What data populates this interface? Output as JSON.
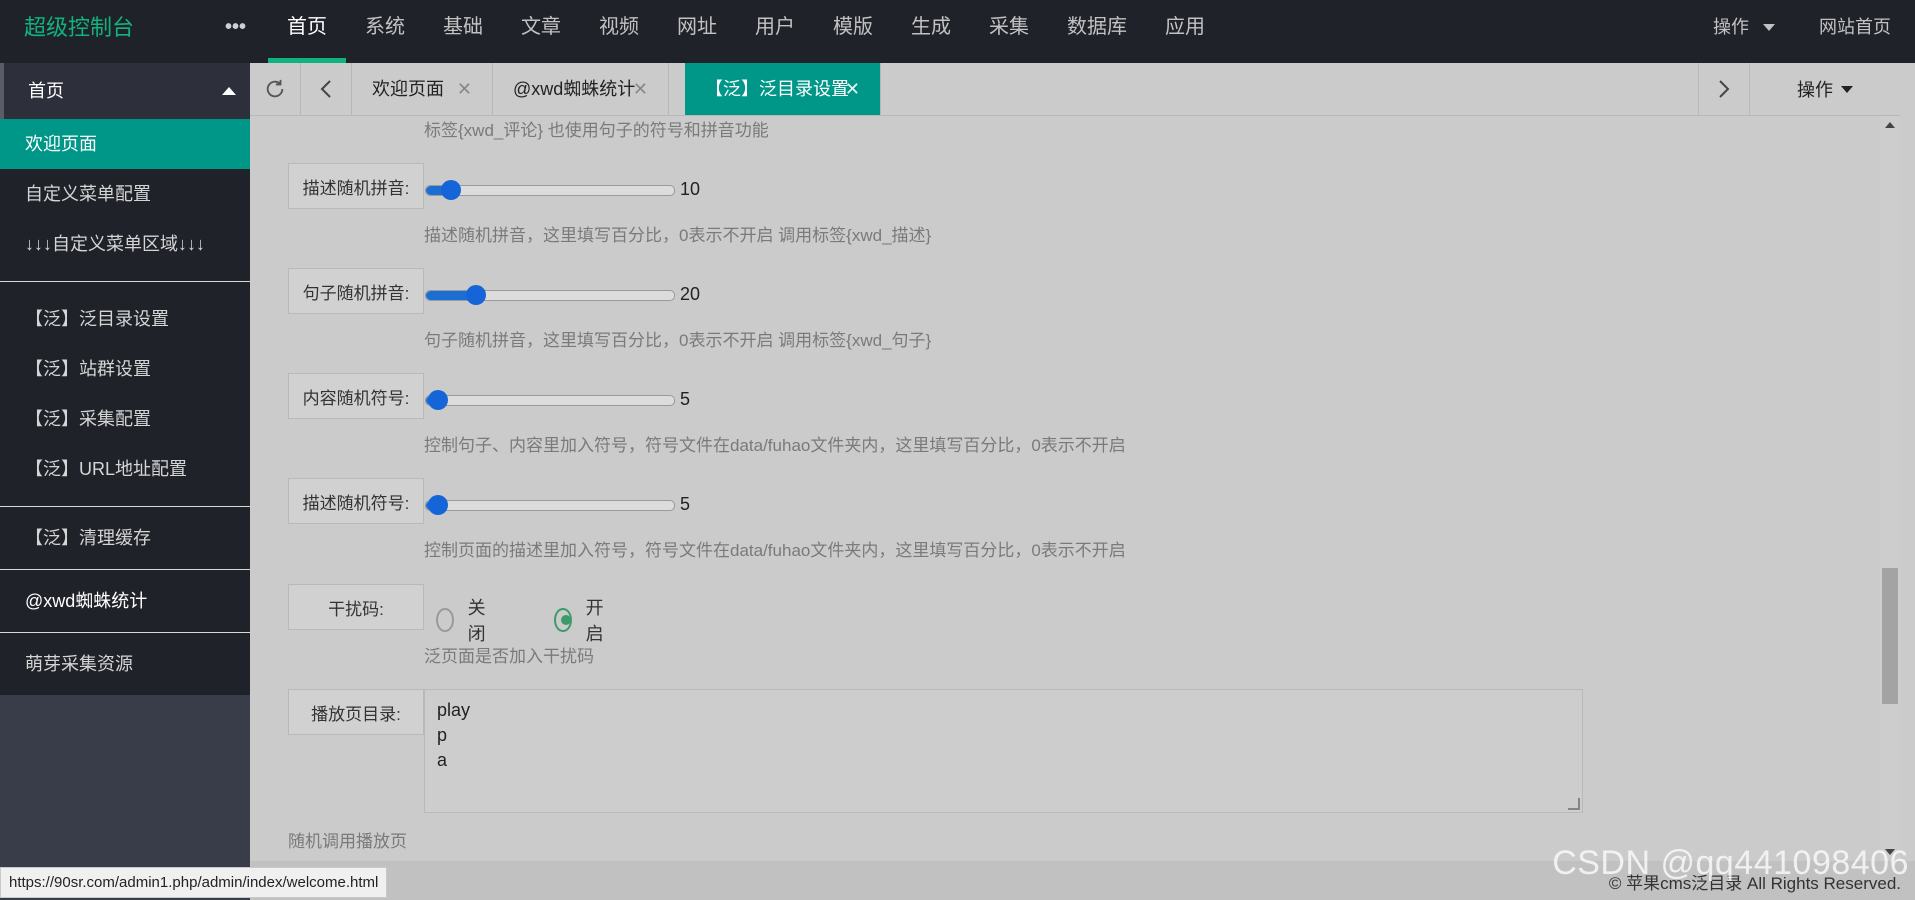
{
  "app": {
    "title": "超级控制台",
    "more": "•••"
  },
  "nav": [
    {
      "label": "首页",
      "active": true
    },
    {
      "label": "系统"
    },
    {
      "label": "基础"
    },
    {
      "label": "文章"
    },
    {
      "label": "视频"
    },
    {
      "label": "网址"
    },
    {
      "label": "用户"
    },
    {
      "label": "模版"
    },
    {
      "label": "生成"
    },
    {
      "label": "采集"
    },
    {
      "label": "数据库"
    },
    {
      "label": "应用"
    }
  ],
  "topright": {
    "ops": "操作",
    "site": "网站首页"
  },
  "sidebar": {
    "head": "首页",
    "group1": [
      "欢迎页面",
      "自定义菜单配置",
      "↓↓↓自定义菜单区域↓↓↓"
    ],
    "group2": [
      "【泛】泛目录设置",
      "【泛】站群设置",
      "【泛】采集配置",
      "【泛】URL地址配置"
    ],
    "group3": [
      "【泛】清理缓存"
    ],
    "group4": [
      "@xwd蜘蛛统计"
    ],
    "group5": [
      "萌芽采集资源"
    ]
  },
  "tabs": [
    {
      "label": "欢迎页面",
      "close": "✕"
    },
    {
      "label": "@xwd蜘蛛统计",
      "close": "✕"
    },
    {
      "label": "【泛】泛目录设置",
      "close": "✕",
      "active": true
    }
  ],
  "tabs_ops": "操作",
  "content": {
    "top_note": "标签{xwd_评论} 也使用句子的符号和拼音功能",
    "sliders": [
      {
        "label": "描述随机拼音:",
        "value": "10",
        "help": "描述随机拼音，这里填写百分比，0表示不开启 调用标签{xwd_描述}",
        "pct": 10
      },
      {
        "label": "句子随机拼音:",
        "value": "20",
        "help": "句子随机拼音，这里填写百分比，0表示不开启 调用标签{xwd_句子}",
        "pct": 20
      },
      {
        "label": "内容随机符号:",
        "value": "5",
        "help": "控制句子、内容里加入符号，符号文件在data/fuhao文件夹内，这里填写百分比，0表示不开启",
        "pct": 5
      },
      {
        "label": "描述随机符号:",
        "value": "5",
        "help": "控制页面的描述里加入符号，符号文件在data/fuhao文件夹内，这里填写百分比，0表示不开启",
        "pct": 5
      }
    ],
    "radio": {
      "label": "干扰码:",
      "off": "关闭",
      "on": "开启",
      "selected": "on",
      "help": "泛页面是否加入干扰码"
    },
    "textarea": {
      "label": "播放页目录:",
      "lines": [
        "play",
        "p",
        "a"
      ]
    },
    "bottom_note": "随机调用播放页"
  },
  "footer": {
    "copyright": "© 苹果cms泛目录 All Rights Reserved."
  },
  "status_url": "https://90sr.com/admin1.php/admin/index/welcome.html",
  "watermark": "CSDN @qq441098406",
  "colors": {
    "accent": "#10b37f",
    "active_tab": "#009688",
    "slider": "#1565d8",
    "radio": "#3d9b6b"
  }
}
